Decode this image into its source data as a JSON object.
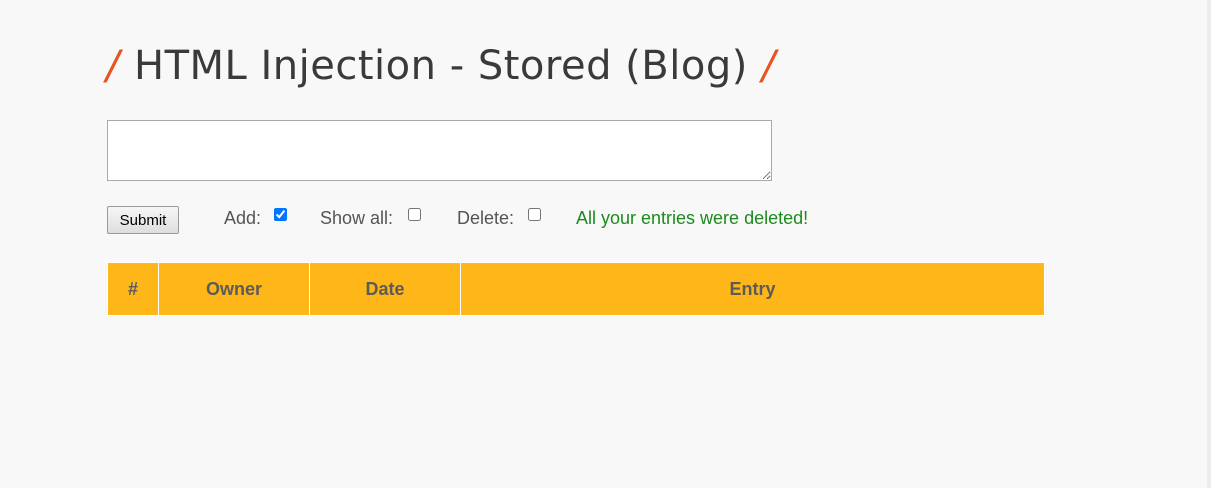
{
  "page": {
    "title_prefix": "/",
    "title": "HTML Injection - Stored (Blog)",
    "title_suffix": "/"
  },
  "form": {
    "entry_value": "",
    "submit_label": "Submit",
    "add_label": "Add:",
    "add_checked": true,
    "show_all_label": "Show all:",
    "show_all_checked": false,
    "delete_label": "Delete:",
    "delete_checked": false,
    "status_message": "All your entries were deleted!"
  },
  "table": {
    "headers": [
      "#",
      "Owner",
      "Date",
      "Entry"
    ],
    "rows": []
  },
  "colors": {
    "accent_slash": "#e8531e",
    "table_header_bg": "#ffb619",
    "status_message": "#1d8a1d"
  }
}
